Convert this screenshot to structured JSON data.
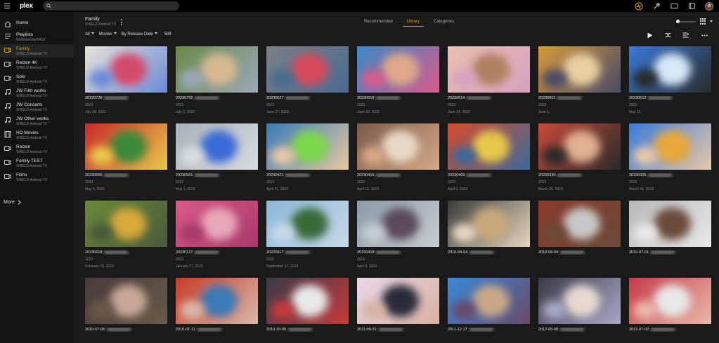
{
  "app": {
    "name": "plex"
  },
  "search": {
    "placeholder": ""
  },
  "sidebar": {
    "items": [
      {
        "title": "Home",
        "subtitle": "",
        "icon": "home-icon"
      },
      {
        "title": "Playlists",
        "subtitle": "WolkskenderNAS2",
        "icon": "playlist-icon"
      },
      {
        "title": "Family",
        "subtitle": "SHIELD Android TV",
        "icon": "video-icon",
        "active": true
      },
      {
        "title": "Reizen 4K",
        "subtitle": "SHIELD Android TV",
        "icon": "video-icon"
      },
      {
        "title": "Solo",
        "subtitle": "SHIELD Android TV",
        "icon": "video-icon"
      },
      {
        "title": "JW Film works",
        "subtitle": "SHIELD Android TV",
        "icon": "music-icon"
      },
      {
        "title": "JW Concerts",
        "subtitle": "SHIELD Android TV",
        "icon": "music-icon"
      },
      {
        "title": "JW Other works",
        "subtitle": "SHIELD Android TV",
        "icon": "music-icon"
      },
      {
        "title": "HD Movies",
        "subtitle": "SHIELD Android TV",
        "icon": "film-icon"
      },
      {
        "title": "Reizen",
        "subtitle": "SHIELD Android TV",
        "icon": "video-icon"
      },
      {
        "title": "Family TEST",
        "subtitle": "SHIELD Android TV",
        "icon": "video-icon"
      },
      {
        "title": "Films",
        "subtitle": "SHIELD Android TV",
        "icon": "video-icon"
      }
    ],
    "more_label": "More"
  },
  "library": {
    "title": "Family",
    "subtitle": "SHIELD Android TV"
  },
  "tabs": [
    {
      "label": "Recommended",
      "active": false
    },
    {
      "label": "Library",
      "active": true
    },
    {
      "label": "Categories",
      "active": false
    }
  ],
  "filters": {
    "all": "All",
    "type": "Movies",
    "sort": "By Release Date",
    "count": "508"
  },
  "colors": {
    "accent": "#e5a00d",
    "background": "#1a1a1a",
    "sidebar": "#141414",
    "topbar": "#000000"
  },
  "tiles": [
    {
      "title": "20230728",
      "year": "2023",
      "date": "July 28, 2023",
      "colors": [
        "#e8e2d8",
        "#d44a6a",
        "#6a8ad8"
      ]
    },
    {
      "title": "20230702",
      "year": "2023",
      "date": "July 2, 2023",
      "colors": [
        "#6a8a4a",
        "#d8b890",
        "#9aa8b8"
      ]
    },
    {
      "title": "20230627",
      "year": "2023",
      "date": "June 27, 2023",
      "colors": [
        "#7a8088",
        "#d84a5a",
        "#4a6a90"
      ]
    },
    {
      "title": "20230618",
      "year": "2023",
      "date": "June 18, 2023",
      "colors": [
        "#3a8ac8",
        "#e0a888",
        "#d85a8a"
      ]
    },
    {
      "title": "20230614",
      "year": "2023",
      "date": "June 14, 2023",
      "colors": [
        "#e8c0b0",
        "#b08060",
        "#d8a0c0"
      ]
    },
    {
      "title": "20230601",
      "year": "2023",
      "date": "June 1,",
      "colors": [
        "#d89a3a",
        "#e8d0a0",
        "#4a4a6a"
      ]
    },
    {
      "title": "20230512",
      "year": "2023",
      "date": "May 12,",
      "colors": [
        "#3a7ad8",
        "#d8e8f8",
        "#2a2a2a"
      ]
    },
    {
      "title": "20230506",
      "year": "2023",
      "date": "May 6, 2023",
      "colors": [
        "#c82a2a",
        "#3a8a3a",
        "#e8c84a"
      ]
    },
    {
      "title": "20230501",
      "year": "2023",
      "date": "May 1, 2023",
      "colors": [
        "#a8b0b8",
        "#3a6ad8",
        "#d8dce0"
      ]
    },
    {
      "title": "20230421",
      "year": "2023",
      "date": "April 21, 2023",
      "colors": [
        "#3a7ab8",
        "#7ad84a",
        "#e8c8a0"
      ]
    },
    {
      "title": "20230415",
      "year": "2023",
      "date": "April 15, 2023",
      "colors": [
        "#7a5a4a",
        "#e8d8c8",
        "#d8a888"
      ]
    },
    {
      "title": "20230409",
      "year": "2023",
      "date": "April 9, 2023",
      "colors": [
        "#d84a2a",
        "#e8c84a",
        "#3a6a9a"
      ]
    },
    {
      "title": "20230330",
      "year": "2023",
      "date": "March 30, 2023",
      "colors": [
        "#c84a3a",
        "#e0b090",
        "#2a2a2a"
      ]
    },
    {
      "title": "20230325",
      "year": "2023",
      "date": "March 25, 2023",
      "colors": [
        "#3a7ad8",
        "#e8a83a",
        "#e8c8a8"
      ]
    },
    {
      "title": "20230218",
      "year": "2023",
      "date": "February 18, 2023",
      "colors": [
        "#6a8a3a",
        "#d8a83a",
        "#4a5a3a"
      ]
    },
    {
      "title": "20230127",
      "year": "2023",
      "date": "January 27, 2023",
      "colors": [
        "#d85a8a",
        "#e8a8b8",
        "#a83a6a"
      ]
    },
    {
      "title": "20220917",
      "year": "2022",
      "date": "September 17, 2022",
      "colors": [
        "#8ab8d8",
        "#3a6a3a",
        "#c8d8e8"
      ]
    },
    {
      "title": "20190418",
      "year": "2019",
      "date": "April 9, 2019",
      "colors": [
        "#8a9aa8",
        "#5a4a5a",
        "#c8ccd0"
      ]
    },
    {
      "title": "2010-04-04",
      "year": "",
      "date": "",
      "colors": [
        "#3a3a3a",
        "#c8a878",
        "#e8d8c0"
      ]
    },
    {
      "title": "2010-06-04",
      "year": "",
      "date": "",
      "colors": [
        "#8a3a2a",
        "#c8c8c8",
        "#6a4a3a"
      ]
    },
    {
      "title": "2010-07-01",
      "year": "",
      "date": "",
      "colors": [
        "#b8b8b8",
        "#6a4a3a",
        "#e8e8e8"
      ]
    },
    {
      "title": "2010-07-06",
      "year": "",
      "date": "",
      "colors": [
        "#4a3a3a",
        "#c8a898",
        "#6a5a4a"
      ]
    },
    {
      "title": "2010-07-11",
      "year": "",
      "date": "",
      "colors": [
        "#c83a2a",
        "#3a7ab8",
        "#d8b8a8"
      ]
    },
    {
      "title": "2010-10-05",
      "year": "",
      "date": "",
      "colors": [
        "#3a3a4a",
        "#e8e8e8",
        "#c83a3a"
      ]
    },
    {
      "title": "2011-09-31",
      "year": "",
      "date": "",
      "colors": [
        "#e8d8e8",
        "#2a2a3a",
        "#d8b0a0"
      ]
    },
    {
      "title": "2011-12-17",
      "year": "",
      "date": "",
      "colors": [
        "#3a8ad8",
        "#c8a888",
        "#6a4a6a"
      ]
    },
    {
      "title": "2012-05-08",
      "year": "",
      "date": "",
      "colors": [
        "#3a3a4a",
        "#e8d8d0",
        "#a8a8c8"
      ]
    },
    {
      "title": "2012-07-02",
      "year": "",
      "date": "",
      "colors": [
        "#c83a4a",
        "#e8e8e8",
        "#e8b8a8"
      ]
    }
  ]
}
